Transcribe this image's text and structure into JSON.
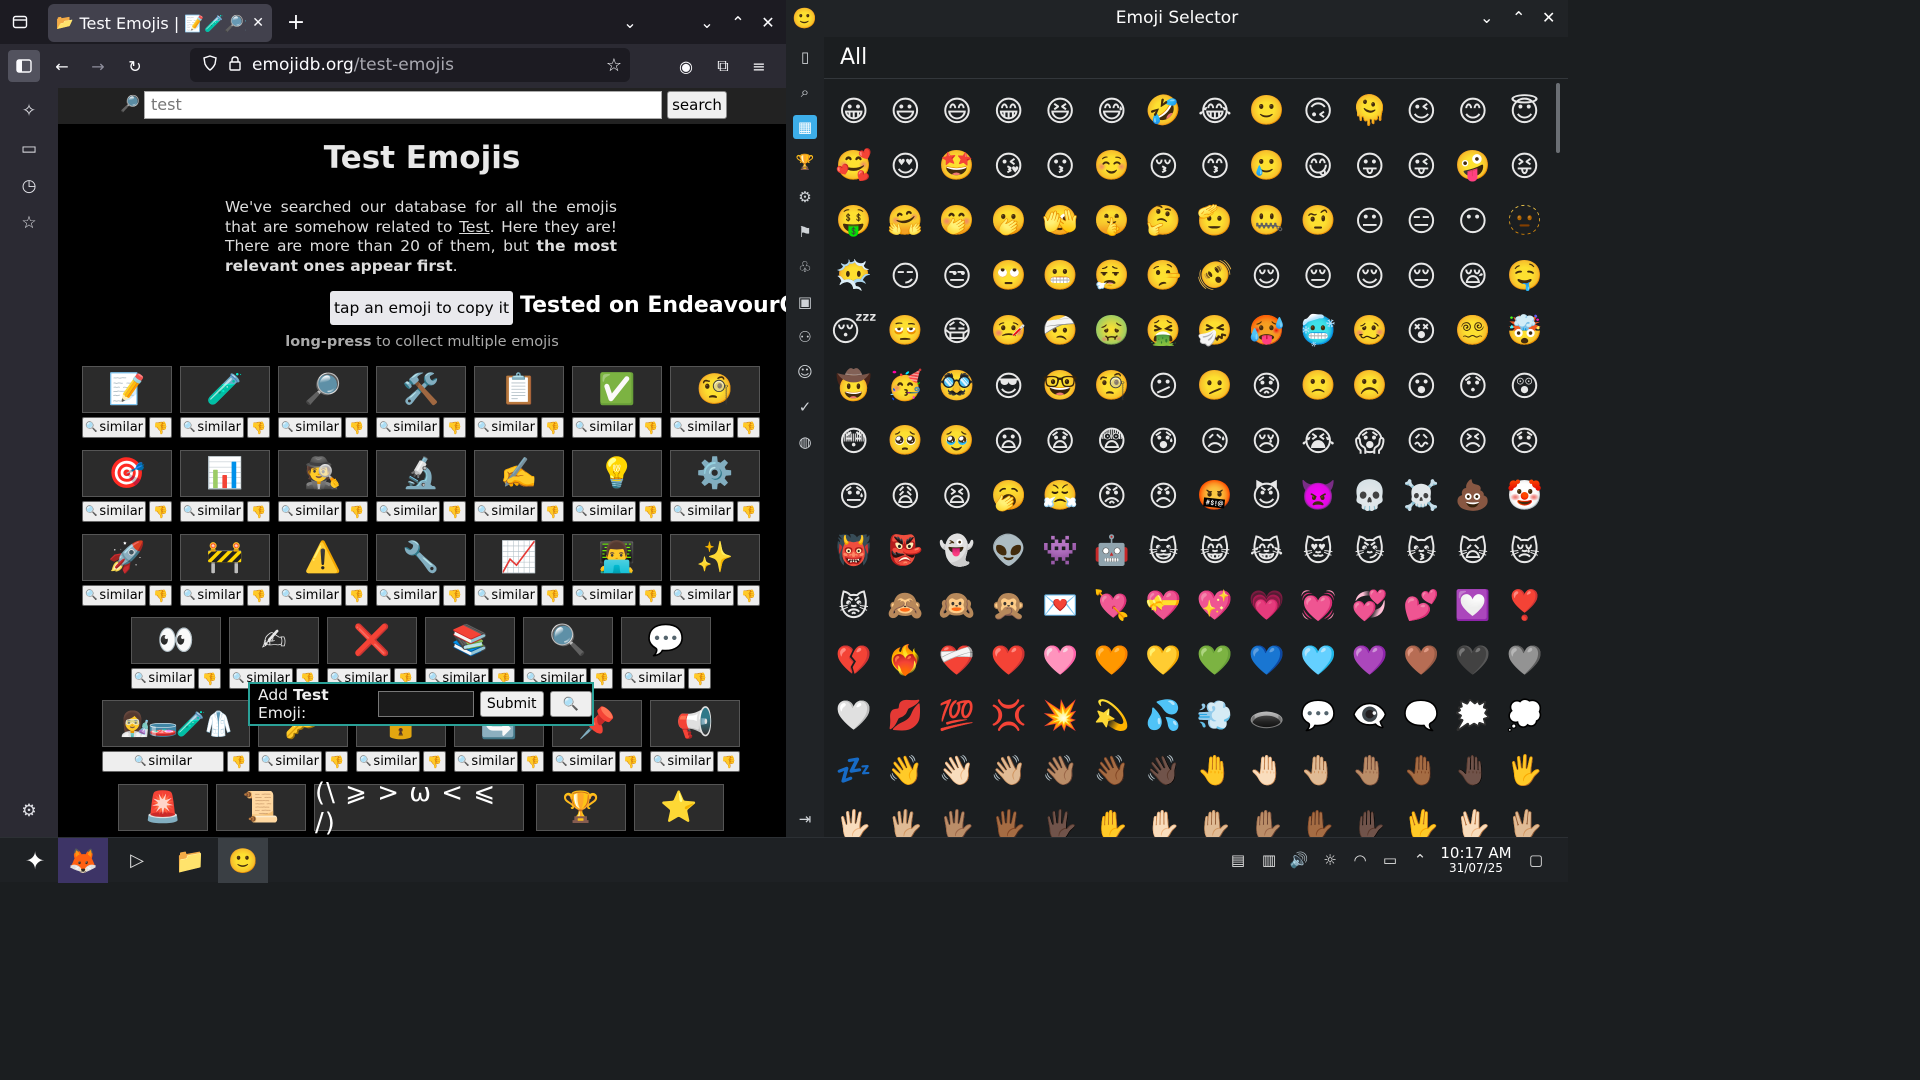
{
  "browser": {
    "tab_title": "Test Emojis | 📝🧪🔎🛠️",
    "new_tab": "+",
    "url_domain": "emojidb.org",
    "url_path": "/test-emojis"
  },
  "page": {
    "search_value": "test",
    "search_button": "search",
    "title": "Test Emojis",
    "intro_1": "We've searched our database for all the emojis that are somehow related to ",
    "intro_link": "Test",
    "intro_2": ". Here they are! There are more than 20 of them, but ",
    "intro_bold": "the most relevant ones appear first",
    "intro_3": ".",
    "copy_button": "tap an emoji to copy it",
    "tested_label": "Tested on EndeavourOS",
    "longpress_bold": "long-press",
    "longpress_rest": " to collect multiple emojis",
    "similar_label": "similar",
    "dislike_icon": "👎",
    "search_glyph": "🔍",
    "rows": [
      [
        "📝",
        "🧪",
        "🔎",
        "🛠️",
        "📋",
        "✅",
        "🧐"
      ],
      [
        "🎯",
        "📊",
        "🕵️",
        "🔬",
        "✍️",
        "💡",
        "⚙️"
      ],
      [
        "🚀",
        "🚧",
        "⚠️",
        "🔧",
        "📈",
        "👨‍💻",
        "✨"
      ],
      [
        "👀",
        "✍",
        "❌",
        "📚",
        "🔍",
        "💬"
      ],
      [
        "👩‍🔬🧫🧪🥼",
        "🔑",
        "🔓",
        "🔄",
        "📌",
        "📢"
      ],
      [
        "🚨",
        "📜",
        "(\\ ⩾ > ω < ⩽ /)",
        "🏆",
        "⭐"
      ]
    ],
    "add_popup": {
      "label_1": "Add ",
      "label_bold": "Test",
      "label_2": " Emoji:",
      "submit": "Submit"
    }
  },
  "selector": {
    "window_title": "Emoji Selector",
    "heading": "All",
    "categories": [
      "recent-icon",
      "search-icon",
      "all-icon",
      "activities-icon",
      "objects-icon",
      "flags-icon",
      "nature-icon",
      "symbols-icon",
      "people-icon",
      "smileys-icon",
      "check-icon",
      "travel-icon"
    ],
    "emojis": [
      "😀",
      "😃",
      "😄",
      "😁",
      "😆",
      "😅",
      "🤣",
      "😂",
      "🙂",
      "🙃",
      "🫠",
      "😉",
      "😊",
      "😇",
      "🥰",
      "😍",
      "🤩",
      "😘",
      "😗",
      "☺️",
      "😚",
      "😙",
      "🥲",
      "😋",
      "😛",
      "😜",
      "🤪",
      "😝",
      "🤑",
      "🤗",
      "🤭",
      "🫢",
      "🫣",
      "🤫",
      "🤔",
      "🫡",
      "🤐",
      "🤨",
      "😐",
      "😑",
      "😶",
      "🫥",
      "😶‍🌫️",
      "😏",
      "😒",
      "🙄",
      "😬",
      "😮‍💨",
      "🤥",
      "🫨",
      "😌",
      "😔",
      "😌",
      "😔",
      "😪",
      "🤤",
      "😴",
      "🫩",
      "😷",
      "🤒",
      "🤕",
      "🤢",
      "🤮",
      "🤧",
      "🥵",
      "🥶",
      "🥴",
      "😵",
      "😵‍💫",
      "🤯",
      "🤠",
      "🥳",
      "🥸",
      "😎",
      "🤓",
      "🧐",
      "😕",
      "🫤",
      "😟",
      "🙁",
      "☹️",
      "😮",
      "😯",
      "😲",
      "😳",
      "🥺",
      "🥹",
      "😦",
      "😧",
      "😨",
      "😰",
      "😥",
      "😢",
      "😭",
      "😱",
      "😖",
      "😣",
      "😞",
      "😓",
      "😩",
      "😫",
      "🥱",
      "😤",
      "😡",
      "😠",
      "🤬",
      "😈",
      "👿",
      "💀",
      "☠️",
      "💩",
      "🤡",
      "👹",
      "👺",
      "👻",
      "👽",
      "👾",
      "🤖",
      "😺",
      "😸",
      "😹",
      "😻",
      "😼",
      "😽",
      "🙀",
      "😿",
      "😾",
      "🙈",
      "🙉",
      "🙊",
      "💌",
      "💘",
      "💝",
      "💖",
      "💗",
      "💓",
      "💞",
      "💕",
      "💟",
      "❣️",
      "💔",
      "❤️‍🔥",
      "❤️‍🩹",
      "❤️",
      "🩷",
      "🧡",
      "💛",
      "💚",
      "💙",
      "🩵",
      "💜",
      "🤎",
      "🖤",
      "🩶",
      "🤍",
      "💋",
      "💯",
      "💢",
      "💥",
      "💫",
      "💦",
      "💨",
      "🕳️",
      "💬",
      "👁️‍🗨️",
      "🗨️",
      "🗯️",
      "💭",
      "💤",
      "👋",
      "👋🏻",
      "👋🏼",
      "👋🏽",
      "👋🏾",
      "👋🏿",
      "🤚",
      "🤚🏻",
      "🤚🏼",
      "🤚🏽",
      "🤚🏾",
      "🤚🏿",
      "🖐️",
      "🖐🏻",
      "🖐🏼",
      "🖐🏽",
      "🖐🏾",
      "🖐🏿",
      "✋",
      "✋🏻",
      "✋🏼",
      "✋🏽",
      "✋🏾",
      "✋🏿",
      "🖖",
      "🖖🏻",
      "🖖🏼"
    ]
  },
  "taskbar": {
    "time": "10:17 AM",
    "date": "31/07/25"
  },
  "colors": {
    "popup_border": "#2aa198",
    "accent": "#3daee9"
  }
}
